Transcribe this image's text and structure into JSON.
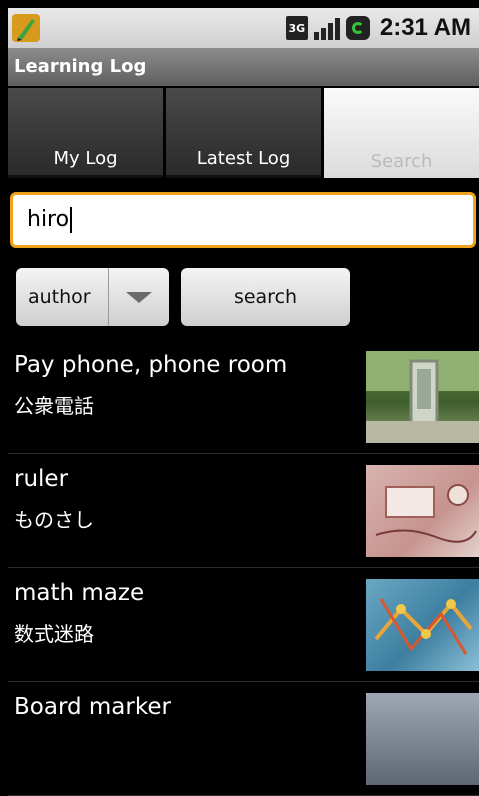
{
  "status_bar": {
    "time": "2:31 AM",
    "network_label": "3G",
    "icons": [
      "app-notification-icon",
      "3g-icon",
      "signal-icon",
      "battery-charging-icon"
    ]
  },
  "app": {
    "title": "Learning Log"
  },
  "tabs": [
    {
      "label": "My Log",
      "selected": false
    },
    {
      "label": "Latest Log",
      "selected": false
    },
    {
      "label": "Search",
      "selected": true
    }
  ],
  "search": {
    "query": "hiro"
  },
  "filter": {
    "selected": "author"
  },
  "search_button": {
    "label": "search"
  },
  "results": [
    {
      "title": "Pay phone, phone room",
      "subtitle": "公衆電話"
    },
    {
      "title": "ruler",
      "subtitle": "ものさし"
    },
    {
      "title": "math maze",
      "subtitle": "数式迷路"
    },
    {
      "title": "Board marker",
      "subtitle": ""
    }
  ],
  "colors": {
    "accent": "#f0a21d",
    "background": "#000000",
    "titlebar": "#6f6f6f",
    "battery": "#39c23b"
  }
}
